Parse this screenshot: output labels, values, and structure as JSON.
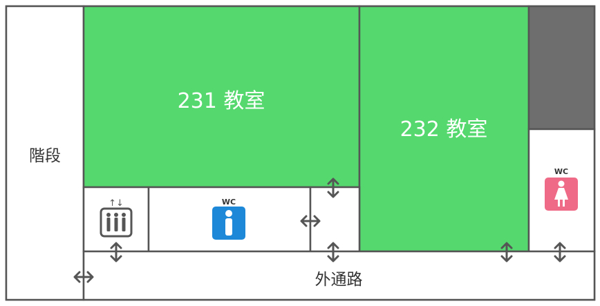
{
  "colors": {
    "classroom": "#55d86e",
    "wall": "#555555",
    "blocked": "#6e6e6e",
    "floor": "#ffffff",
    "restroom_men_accessible": "#1e88d8",
    "restroom_women": "#ef6a86",
    "door_arrow": "#555555"
  },
  "rooms": {
    "stairs": "階段",
    "classroom_231": "231 教室",
    "classroom_232": "232 教室",
    "corridor": "外通路"
  },
  "restrooms": {
    "accessible_wc_label": "WC",
    "women_wc_label": "WC"
  },
  "icons": {
    "elevator": "elevator-icon",
    "elevator_arrows": "↑↓",
    "accessible_wc": "accessible-restroom-icon",
    "women_wc": "women-restroom-icon",
    "door": "door-arrow-icon"
  }
}
